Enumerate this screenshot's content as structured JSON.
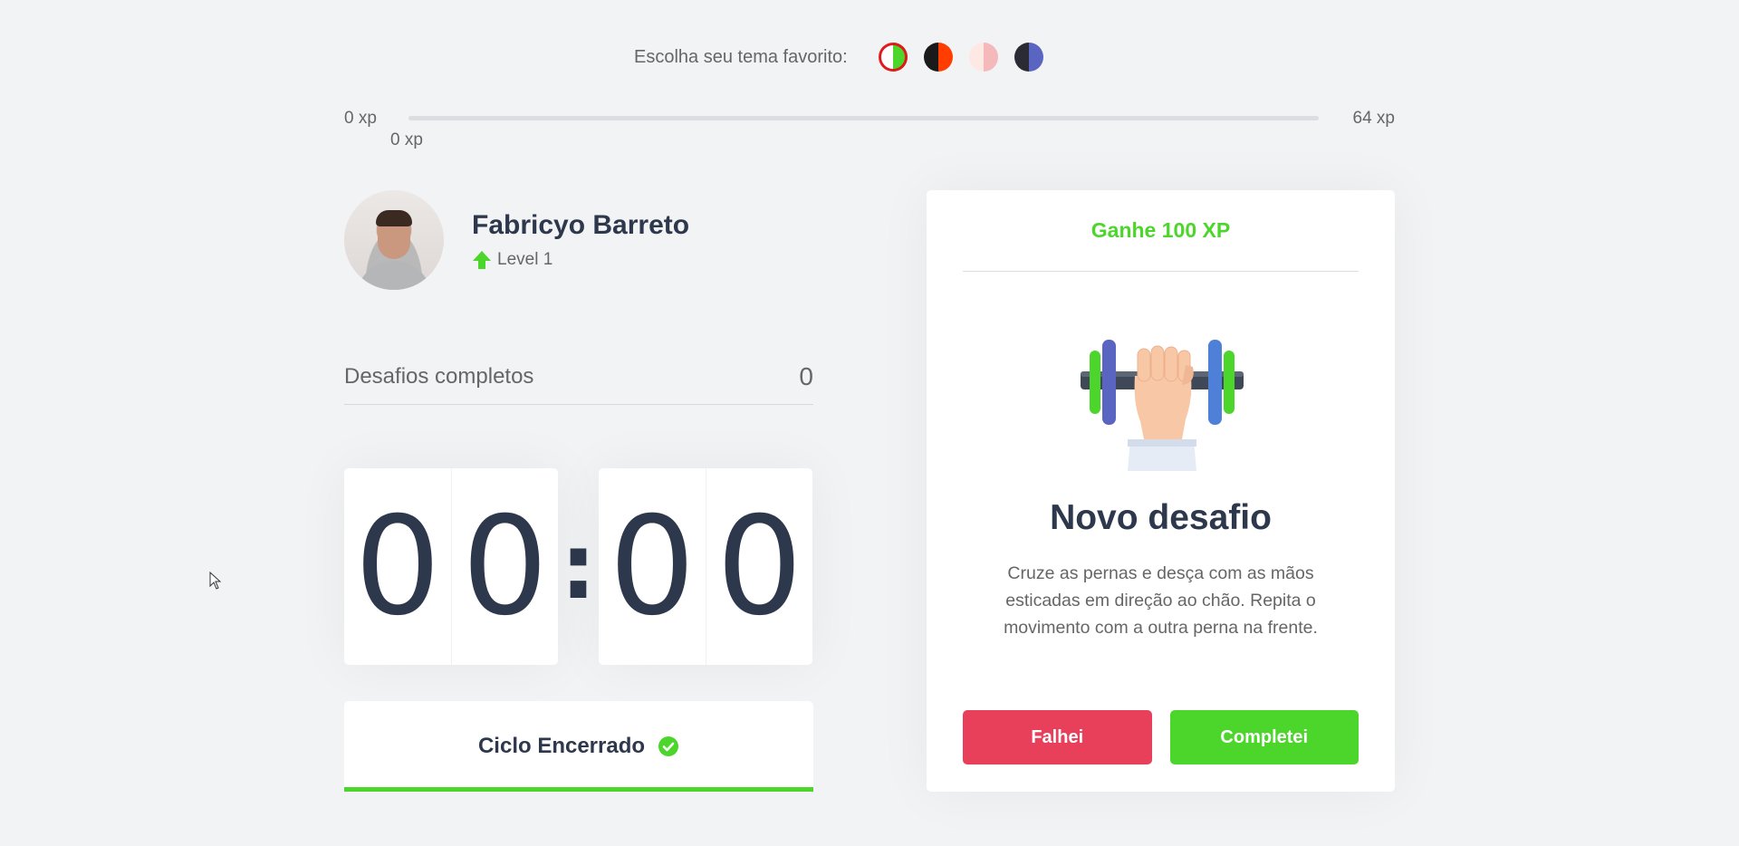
{
  "theme": {
    "label": "Escolha seu tema favorito:",
    "options": [
      {
        "name": "verde",
        "left": "#ffffff",
        "right": "#4cd62b",
        "selected": true
      },
      {
        "name": "escuro",
        "left": "#1a1a1a",
        "right": "#ff3d00",
        "selected": false
      },
      {
        "name": "rosa",
        "left": "#fde8e3",
        "right": "#f5b8bb",
        "selected": false
      },
      {
        "name": "azul",
        "left": "#2b2b36",
        "right": "#5965c0",
        "selected": false
      }
    ]
  },
  "xp": {
    "min_label": "0 xp",
    "max_label": "64 xp",
    "current_label": "0 xp",
    "progress_fraction": 0
  },
  "profile": {
    "name": "Fabricyo Barreto",
    "level": "Level 1"
  },
  "completed": {
    "label": "Desafios completos",
    "count": "0"
  },
  "countdown": {
    "minute_left": "0",
    "minute_right": "0",
    "separator": ":",
    "second_left": "0",
    "second_right": "0"
  },
  "cycle": {
    "label": "Ciclo Encerrado",
    "progress_fraction": 1
  },
  "challenge": {
    "header": "Ganhe 100 XP",
    "title": "Novo desafio",
    "description": "Cruze as pernas e desça com as mãos esticadas em direção ao chão. Repita o movimento com a outra perna na frente.",
    "fail_label": "Falhei",
    "success_label": "Completei"
  },
  "colors": {
    "background": "#f2f3f5",
    "green": "#4cd62b",
    "red": "#e83f5b",
    "title": "#2e384d",
    "text": "#666666"
  }
}
